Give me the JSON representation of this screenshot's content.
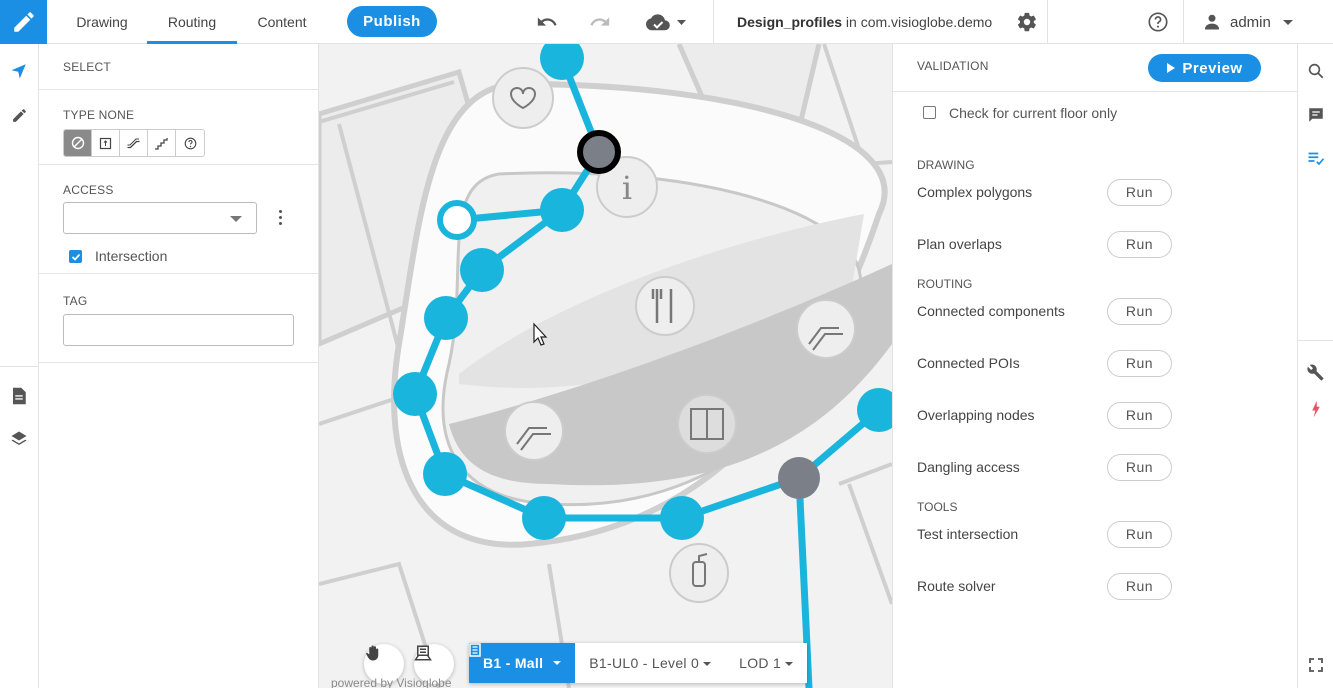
{
  "topbar": {
    "tabs": [
      "Drawing",
      "Routing",
      "Content"
    ],
    "active_tab": "Routing",
    "publish_label": "Publish",
    "project_name": "Design_profiles",
    "project_suffix": " in com.visioglobe.demo",
    "user": "admin"
  },
  "select_panel": {
    "title": "SELECT",
    "type_label": "TYPE NONE",
    "type_buttons": [
      "none-icon",
      "door-icon",
      "escalator-icon",
      "stairs-icon",
      "unknown-icon"
    ],
    "access_label": "ACCESS",
    "access_value": "",
    "intersection_label": "Intersection",
    "intersection_checked": true,
    "tag_label": "TAG",
    "tag_value": ""
  },
  "map": {
    "floor_building": "B1 - Mall",
    "floor_level": "B1-UL0 - Level 0",
    "lod": "LOD 1",
    "powered_by": "powered by Visioglobe"
  },
  "validation": {
    "title": "VALIDATION",
    "preview_label": "Preview",
    "current_floor_label": "Check for current floor only",
    "current_floor_checked": false,
    "sections": [
      {
        "name": "DRAWING",
        "checks": [
          "Complex polygons",
          "Plan overlaps"
        ]
      },
      {
        "name": "ROUTING",
        "checks": [
          "Connected components",
          "Connected POIs",
          "Overlapping nodes",
          "Dangling access"
        ]
      },
      {
        "name": "TOOLS",
        "checks": [
          "Test intersection",
          "Route solver"
        ]
      }
    ],
    "run_label": "Run"
  },
  "colors": {
    "accent": "#1a8fe3",
    "route": "#1ab5dc",
    "node_gray": "#7a7f88"
  }
}
